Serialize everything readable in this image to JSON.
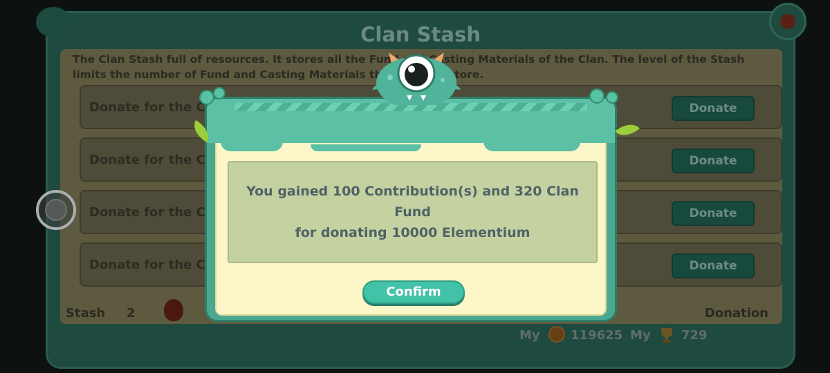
{
  "stash_panel": {
    "title": "Clan Stash",
    "description": "The Clan Stash full of resources. It stores all the Fund and Casting Materials of the Clan. The level of the Stash limits the number of Fund and Casting Materials the Clan can store.",
    "rows": [
      {
        "label": "Donate for the Clan",
        "button": "Donate"
      },
      {
        "label": "Donate for the Clan",
        "button": "Donate"
      },
      {
        "label": "Donate for the Clan",
        "button": "Donate"
      },
      {
        "label": "Donate for the Clan",
        "button": "Donate"
      }
    ],
    "footer": {
      "stash_label": "Stash",
      "stash_level": "2",
      "donation_label": "Donation"
    },
    "my_fund": {
      "label": "My",
      "value": "119625",
      "icon": "fund-coin-icon"
    },
    "my_contribution": {
      "label": "My",
      "value": "729",
      "icon": "trophy-icon"
    }
  },
  "dialog": {
    "message_line1": "You gained 100 Contribution(s) and 320 Clan Fund",
    "message_line2": "for donating 10000 Elementium",
    "confirm_label": "Confirm"
  },
  "colors": {
    "dialog_teal": "#4aa890",
    "dialog_paper": "#fdf6c8",
    "message_bg": "#c4d2a2",
    "confirm_button": "#42c2a6"
  }
}
